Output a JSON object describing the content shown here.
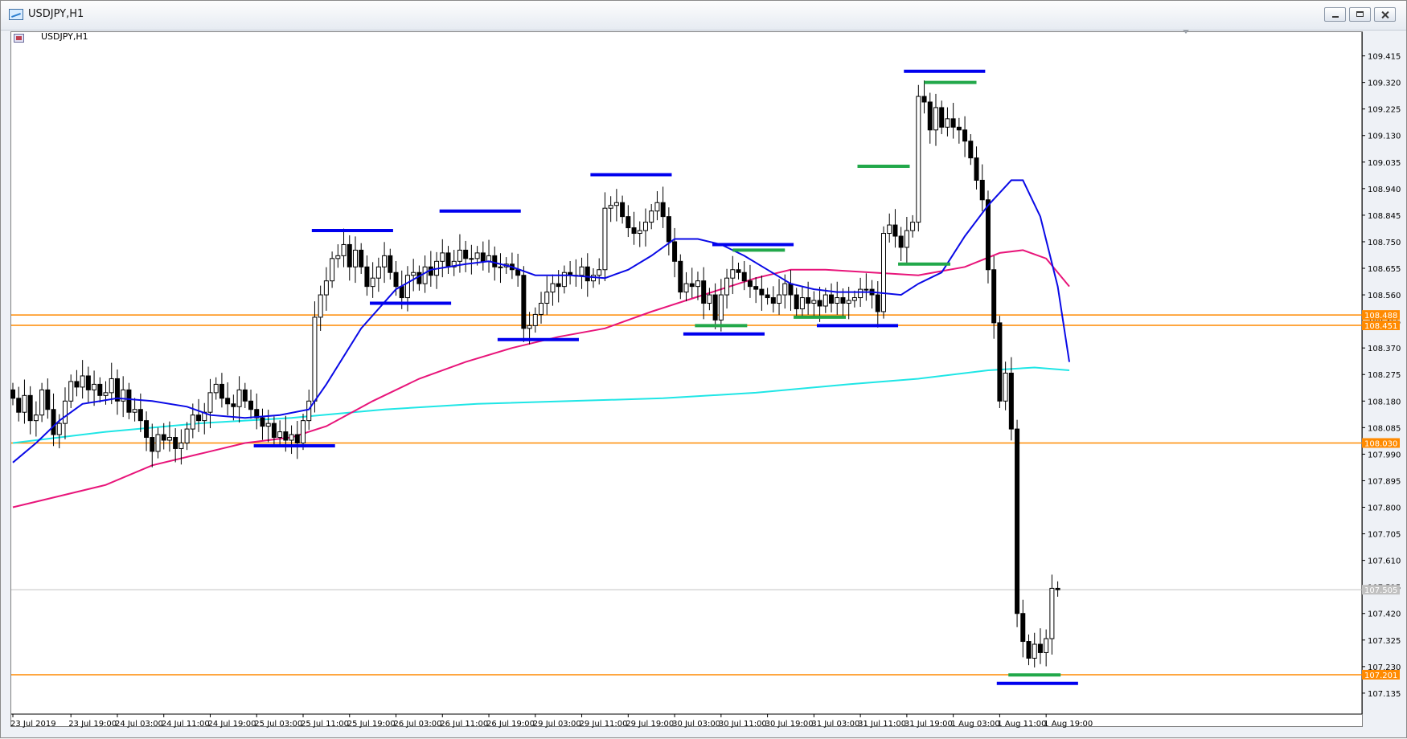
{
  "window": {
    "title": "USDJPY,H1"
  },
  "chart_header": {
    "symbol": "USDJPY,H1"
  },
  "colors": {
    "up": "#ffffff",
    "down": "#000000",
    "wick": "#000000",
    "ma_fast": "#0a0ae6",
    "ma_mid": "#e8157a",
    "ma_slow": "#1fe6e6",
    "level": "#ff8a00",
    "mark_blue": "#0000ee",
    "mark_green": "#22a84a",
    "grid_current": "#c0c0c0"
  },
  "chart_data": {
    "type": "candlestick",
    "ylim": [
      107.06,
      109.5
    ],
    "yticks": [
      "109.415",
      "109.320",
      "109.225",
      "109.130",
      "109.035",
      "108.940",
      "108.845",
      "108.750",
      "108.655",
      "108.560",
      "108.465",
      "108.370",
      "108.275",
      "108.180",
      "108.085",
      "107.990",
      "107.895",
      "107.800",
      "107.705",
      "107.610",
      "107.515",
      "107.420",
      "107.325",
      "107.230",
      "107.135"
    ],
    "xticks": [
      {
        "label": "23 Jul 2019",
        "i": 0
      },
      {
        "label": "23 Jul 19:00",
        "i": 10
      },
      {
        "label": "24 Jul 03:00",
        "i": 18
      },
      {
        "label": "24 Jul 11:00",
        "i": 26
      },
      {
        "label": "24 Jul 19:00",
        "i": 34
      },
      {
        "label": "25 Jul 03:00",
        "i": 42
      },
      {
        "label": "25 Jul 11:00",
        "i": 50
      },
      {
        "label": "25 Jul 19:00",
        "i": 58
      },
      {
        "label": "26 Jul 03:00",
        "i": 66
      },
      {
        "label": "26 Jul 11:00",
        "i": 74
      },
      {
        "label": "26 Jul 19:00",
        "i": 82
      },
      {
        "label": "29 Jul 03:00",
        "i": 90
      },
      {
        "label": "29 Jul 11:00",
        "i": 98
      },
      {
        "label": "29 Jul 19:00",
        "i": 106
      },
      {
        "label": "30 Jul 03:00",
        "i": 114
      },
      {
        "label": "30 Jul 11:00",
        "i": 122
      },
      {
        "label": "30 Jul 19:00",
        "i": 130
      },
      {
        "label": "31 Jul 03:00",
        "i": 138
      },
      {
        "label": "31 Jul 11:00",
        "i": 146
      },
      {
        "label": "31 Jul 19:00",
        "i": 154
      },
      {
        "label": "1 Aug 03:00",
        "i": 162
      },
      {
        "label": "1 Aug 11:00",
        "i": 170
      },
      {
        "label": "1 Aug 19:00",
        "i": 178
      }
    ],
    "closes": [
      108.19,
      108.14,
      108.2,
      108.11,
      108.13,
      108.22,
      108.15,
      108.06,
      108.1,
      108.18,
      108.25,
      108.23,
      108.27,
      108.22,
      108.24,
      108.2,
      108.21,
      108.26,
      108.18,
      108.22,
      108.14,
      108.15,
      108.11,
      108.05,
      108.0,
      108.06,
      108.04,
      108.05,
      108.01,
      108.03,
      108.08,
      108.13,
      108.11,
      108.14,
      108.21,
      108.24,
      108.19,
      108.17,
      108.16,
      108.22,
      108.18,
      108.15,
      108.12,
      108.09,
      108.1,
      108.05,
      108.07,
      108.04,
      108.06,
      108.03,
      108.11,
      108.18,
      108.48,
      108.56,
      108.61,
      108.69,
      108.7,
      108.74,
      108.66,
      108.72,
      108.66,
      108.59,
      108.62,
      108.66,
      108.7,
      108.64,
      108.59,
      108.55,
      108.63,
      108.64,
      108.6,
      108.66,
      108.63,
      108.68,
      108.71,
      108.66,
      108.68,
      108.72,
      108.69,
      108.69,
      108.71,
      108.68,
      108.7,
      108.66,
      108.66,
      108.67,
      108.65,
      108.63,
      108.44,
      108.45,
      108.49,
      108.53,
      108.57,
      108.6,
      108.59,
      108.64,
      108.63,
      108.63,
      108.66,
      108.61,
      108.63,
      108.65,
      108.87,
      108.88,
      108.89,
      108.84,
      108.8,
      108.78,
      108.79,
      108.82,
      108.86,
      108.89,
      108.84,
      108.75,
      108.68,
      108.57,
      108.6,
      108.59,
      108.61,
      108.53,
      108.56,
      108.47,
      108.56,
      108.62,
      108.65,
      108.64,
      108.61,
      108.59,
      108.58,
      108.56,
      108.55,
      108.53,
      108.56,
      108.6,
      108.56,
      108.51,
      108.55,
      108.53,
      108.54,
      108.52,
      108.56,
      108.53,
      108.55,
      108.53,
      108.54,
      108.55,
      108.58,
      108.58,
      108.56,
      108.5,
      108.78,
      108.81,
      108.77,
      108.73,
      108.79,
      108.82,
      109.27,
      109.25,
      109.15,
      109.23,
      109.16,
      109.19,
      109.16,
      109.15,
      109.11,
      109.05,
      108.97,
      108.9,
      108.65,
      108.46,
      108.18,
      108.28,
      108.08,
      107.42,
      107.32,
      107.26,
      107.31,
      107.28,
      107.33,
      107.51,
      107.505
    ],
    "current_price": "107.505",
    "levels": [
      "108.488",
      "108.451",
      "108.030",
      "107.201"
    ],
    "ma_fast": [
      {
        "i": 0,
        "v": 107.96
      },
      {
        "i": 4,
        "v": 108.03
      },
      {
        "i": 8,
        "v": 108.11
      },
      {
        "i": 12,
        "v": 108.17
      },
      {
        "i": 18,
        "v": 108.19
      },
      {
        "i": 24,
        "v": 108.18
      },
      {
        "i": 30,
        "v": 108.16
      },
      {
        "i": 34,
        "v": 108.13
      },
      {
        "i": 40,
        "v": 108.12
      },
      {
        "i": 46,
        "v": 108.13
      },
      {
        "i": 51,
        "v": 108.15
      },
      {
        "i": 54,
        "v": 108.24
      },
      {
        "i": 60,
        "v": 108.44
      },
      {
        "i": 66,
        "v": 108.58
      },
      {
        "i": 72,
        "v": 108.65
      },
      {
        "i": 78,
        "v": 108.67
      },
      {
        "i": 82,
        "v": 108.68
      },
      {
        "i": 86,
        "v": 108.66
      },
      {
        "i": 90,
        "v": 108.63
      },
      {
        "i": 96,
        "v": 108.63
      },
      {
        "i": 102,
        "v": 108.62
      },
      {
        "i": 106,
        "v": 108.65
      },
      {
        "i": 110,
        "v": 108.7
      },
      {
        "i": 114,
        "v": 108.76
      },
      {
        "i": 118,
        "v": 108.76
      },
      {
        "i": 122,
        "v": 108.74
      },
      {
        "i": 126,
        "v": 108.7
      },
      {
        "i": 130,
        "v": 108.65
      },
      {
        "i": 134,
        "v": 108.6
      },
      {
        "i": 138,
        "v": 108.58
      },
      {
        "i": 142,
        "v": 108.57
      },
      {
        "i": 148,
        "v": 108.57
      },
      {
        "i": 153,
        "v": 108.56
      },
      {
        "i": 156,
        "v": 108.6
      },
      {
        "i": 160,
        "v": 108.64
      },
      {
        "i": 164,
        "v": 108.77
      },
      {
        "i": 168,
        "v": 108.88
      },
      {
        "i": 172,
        "v": 108.97
      },
      {
        "i": 174,
        "v": 108.97
      },
      {
        "i": 177,
        "v": 108.84
      },
      {
        "i": 180,
        "v": 108.59
      },
      {
        "i": 182,
        "v": 108.32
      }
    ],
    "ma_mid": [
      {
        "i": 0,
        "v": 107.8
      },
      {
        "i": 8,
        "v": 107.84
      },
      {
        "i": 16,
        "v": 107.88
      },
      {
        "i": 24,
        "v": 107.95
      },
      {
        "i": 32,
        "v": 107.99
      },
      {
        "i": 40,
        "v": 108.03
      },
      {
        "i": 48,
        "v": 108.05
      },
      {
        "i": 54,
        "v": 108.09
      },
      {
        "i": 62,
        "v": 108.18
      },
      {
        "i": 70,
        "v": 108.26
      },
      {
        "i": 78,
        "v": 108.32
      },
      {
        "i": 86,
        "v": 108.37
      },
      {
        "i": 94,
        "v": 108.41
      },
      {
        "i": 102,
        "v": 108.44
      },
      {
        "i": 110,
        "v": 108.5
      },
      {
        "i": 116,
        "v": 108.54
      },
      {
        "i": 122,
        "v": 108.58
      },
      {
        "i": 128,
        "v": 108.62
      },
      {
        "i": 134,
        "v": 108.65
      },
      {
        "i": 140,
        "v": 108.65
      },
      {
        "i": 148,
        "v": 108.64
      },
      {
        "i": 156,
        "v": 108.63
      },
      {
        "i": 164,
        "v": 108.66
      },
      {
        "i": 170,
        "v": 108.71
      },
      {
        "i": 174,
        "v": 108.72
      },
      {
        "i": 178,
        "v": 108.69
      },
      {
        "i": 182,
        "v": 108.59
      }
    ],
    "ma_slow": [
      {
        "i": 0,
        "v": 108.03
      },
      {
        "i": 16,
        "v": 108.07
      },
      {
        "i": 32,
        "v": 108.1
      },
      {
        "i": 48,
        "v": 108.12
      },
      {
        "i": 64,
        "v": 108.15
      },
      {
        "i": 80,
        "v": 108.17
      },
      {
        "i": 96,
        "v": 108.18
      },
      {
        "i": 112,
        "v": 108.19
      },
      {
        "i": 128,
        "v": 108.21
      },
      {
        "i": 144,
        "v": 108.24
      },
      {
        "i": 156,
        "v": 108.26
      },
      {
        "i": 168,
        "v": 108.29
      },
      {
        "i": 176,
        "v": 108.3
      },
      {
        "i": 182,
        "v": 108.29
      }
    ],
    "zones": [
      {
        "c": "mark_blue",
        "i1": 51.5,
        "i2": 65.5,
        "v": 108.79
      },
      {
        "c": "mark_blue",
        "i1": 61.5,
        "i2": 75.5,
        "v": 108.53
      },
      {
        "c": "mark_blue",
        "i1": 73.5,
        "i2": 87.5,
        "v": 108.86
      },
      {
        "c": "mark_blue",
        "i1": 83.5,
        "i2": 97.5,
        "v": 108.4
      },
      {
        "c": "mark_blue",
        "i1": 99.5,
        "i2": 113.5,
        "v": 108.99
      },
      {
        "c": "mark_blue",
        "i1": 41.5,
        "i2": 55.5,
        "v": 108.02
      },
      {
        "c": "mark_blue",
        "i1": 120.5,
        "i2": 134.5,
        "v": 108.74
      },
      {
        "c": "mark_green",
        "i1": 124,
        "i2": 133,
        "v": 108.72
      },
      {
        "c": "mark_green",
        "i1": 117.5,
        "i2": 126.5,
        "v": 108.45
      },
      {
        "c": "mark_blue",
        "i1": 115.5,
        "i2": 129.5,
        "v": 108.42
      },
      {
        "c": "mark_green",
        "i1": 134.5,
        "i2": 143.5,
        "v": 108.48
      },
      {
        "c": "mark_blue",
        "i1": 138.5,
        "i2": 152.5,
        "v": 108.45
      },
      {
        "c": "mark_green",
        "i1": 145.5,
        "i2": 154.5,
        "v": 109.02
      },
      {
        "c": "mark_green",
        "i1": 152.5,
        "i2": 161.5,
        "v": 108.67
      },
      {
        "c": "mark_blue",
        "i1": 153.5,
        "i2": 167.5,
        "v": 109.36
      },
      {
        "c": "mark_green",
        "i1": 157,
        "i2": 166,
        "v": 109.32
      },
      {
        "c": "mark_green",
        "i1": 171.5,
        "i2": 180.5,
        "v": 107.2
      },
      {
        "c": "mark_blue",
        "i1": 169.5,
        "i2": 183.5,
        "v": 107.17
      }
    ]
  }
}
